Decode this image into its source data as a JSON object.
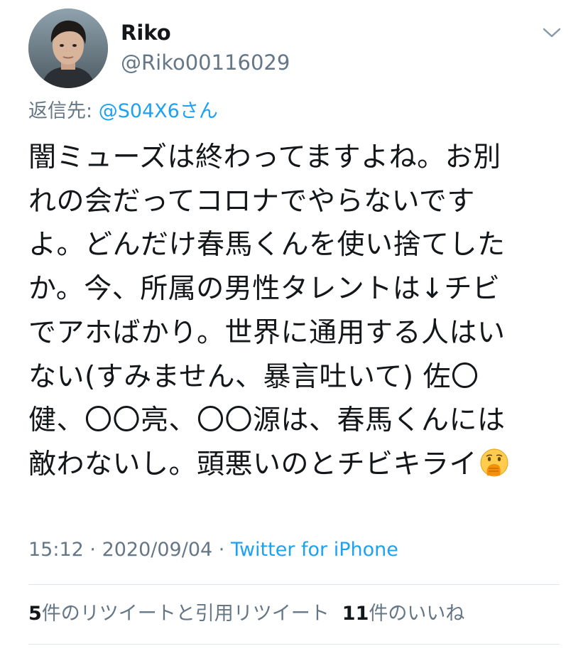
{
  "user": {
    "display_name": "Riko",
    "handle": "@Riko00116029"
  },
  "reply": {
    "prefix": "返信先: ",
    "target": "@S04X6さん"
  },
  "tweet": {
    "text": "闇ミューズは終わってますよね。お別\nれの会だってコロナでやらないです\nよ。どんだけ春馬くんを使い捨てした\nか。今、所属の男性タレントは↓チビ\nでアホばかり。世界に通用する人はい\nない(すみません、暴言吐いて) 佐〇\n健、〇〇亮、〇〇源は、春馬くんには\n敵わないし。頭悪いのとチビキライ",
    "trailing_emoji": "face-with-hand-over-mouth-emoji"
  },
  "meta": {
    "time": "15:12",
    "separator": " · ",
    "date": "2020/09/04",
    "source": "Twitter for iPhone"
  },
  "stats": {
    "retweets_count": "5",
    "retweets_label": "件のリツイートと引用リツイート",
    "likes_count": "11",
    "likes_label": "件のいいね"
  },
  "icons": {
    "menu": "chevron-down-icon",
    "avatar": "avatar"
  },
  "colors": {
    "text_primary": "#14171a",
    "text_secondary": "#657786",
    "link": "#1da1f2",
    "divider": "#e1e8ed"
  }
}
